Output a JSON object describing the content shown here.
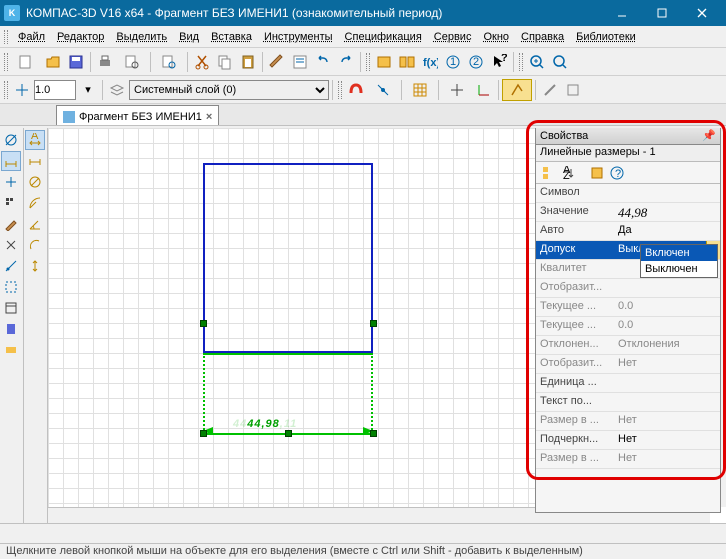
{
  "title": "КОМПАС-3D V16  x64 - Фрагмент БЕЗ ИМЕНИ1 (ознакомительный период)",
  "menu": [
    "Файл",
    "Редактор",
    "Выделить",
    "Вид",
    "Вставка",
    "Инструменты",
    "Спецификация",
    "Сервис",
    "Окно",
    "Справка",
    "Библиотеки"
  ],
  "toolbar2": {
    "num_value": "1.0",
    "layer_value": "Системный слой (0)"
  },
  "tab": {
    "label": "Фрагмент БЕЗ ИМЕНИ1"
  },
  "canvas": {
    "dim_value": "44,98"
  },
  "props": {
    "title": "Свойства",
    "subtitle": "Линейные размеры - 1",
    "rows": [
      {
        "k": "Символ",
        "v": ""
      },
      {
        "k": "Значение",
        "v": "44,98",
        "italic": true
      },
      {
        "k": "Авто",
        "v": "Да"
      },
      {
        "k": "Допуск",
        "v": "Выключен",
        "sel": true,
        "dd": true
      },
      {
        "k": "Квалитет",
        "v": "",
        "disabled": true
      },
      {
        "k": "Отобразит...",
        "v": "",
        "disabled": true
      },
      {
        "k": "Текущее ...",
        "v": "0.0",
        "disabled": true
      },
      {
        "k": "Текущее ...",
        "v": "0.0",
        "disabled": true
      },
      {
        "k": "Отклонен...",
        "v": "Отклонения",
        "disabled": true
      },
      {
        "k": "Отобразит...",
        "v": "Нет",
        "disabled": true
      },
      {
        "k": "Единица ...",
        "v": ""
      },
      {
        "k": "Текст по...",
        "v": ""
      },
      {
        "k": "Размер в ...",
        "v": "Нет",
        "disabled": true
      },
      {
        "k": "Подчеркн...",
        "v": "Нет"
      },
      {
        "k": "Размер в ...",
        "v": "Нет",
        "disabled": true
      }
    ],
    "dropdown": [
      "Включен",
      "Выключен"
    ],
    "dropdown_sel": 0
  },
  "status": "Щелкните левой кнопкой мыши на объекте для его выделения (вместе с Ctrl или Shift - добавить к выделенным)"
}
